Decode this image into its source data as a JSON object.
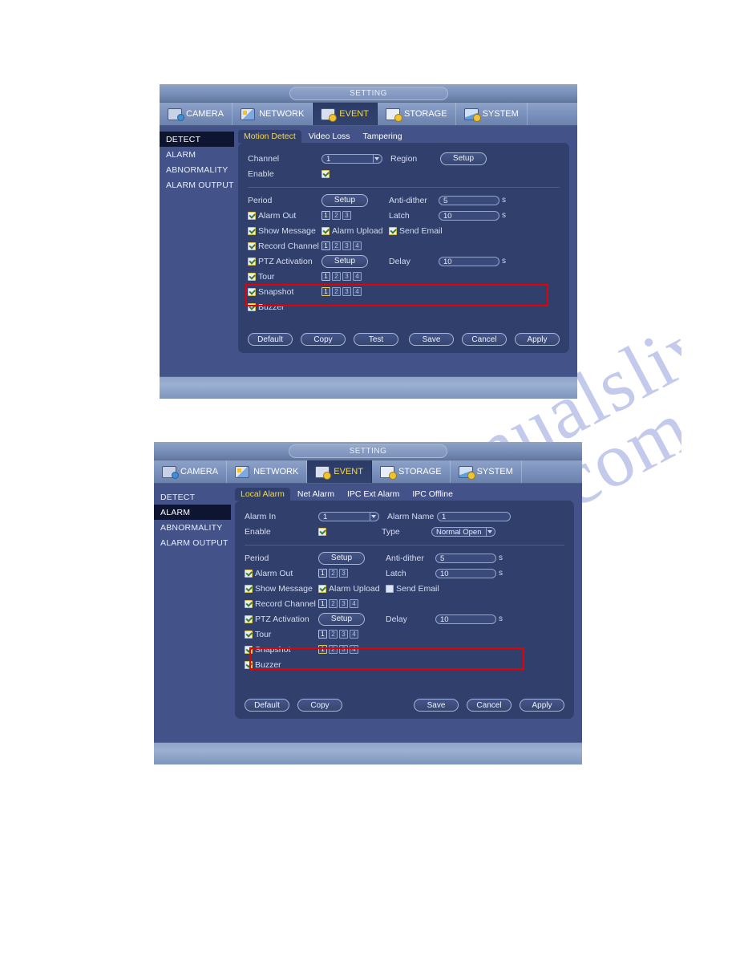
{
  "watermark": {
    "line1": "manualslive.com",
    "line2": "manualslive.com"
  },
  "panels": [
    {
      "title": "SETTING",
      "main_tabs": [
        {
          "label": "CAMERA",
          "icon": "camera-icon",
          "active": false
        },
        {
          "label": "NETWORK",
          "icon": "network-icon",
          "active": false
        },
        {
          "label": "EVENT",
          "icon": "event-icon",
          "active": true
        },
        {
          "label": "STORAGE",
          "icon": "storage-icon",
          "active": false
        },
        {
          "label": "SYSTEM",
          "icon": "system-icon",
          "active": false
        }
      ],
      "sidebar": [
        {
          "label": "DETECT",
          "active": true
        },
        {
          "label": "ALARM",
          "active": false
        },
        {
          "label": "ABNORMALITY",
          "active": false
        },
        {
          "label": "ALARM OUTPUT",
          "active": false
        }
      ],
      "sub_tabs": [
        {
          "label": "Motion Detect",
          "active": true
        },
        {
          "label": "Video Loss",
          "active": false
        },
        {
          "label": "Tampering",
          "active": false
        }
      ],
      "form": {
        "channel_label": "Channel",
        "channel_value": "1",
        "region_label": "Region",
        "region_button": "Setup",
        "enable_label": "Enable",
        "enable_checked": true,
        "period_label": "Period",
        "period_button": "Setup",
        "antidither_label": "Anti-dither",
        "antidither_value": "5",
        "antidither_unit": "s",
        "alarm_out_label": "Alarm Out",
        "alarm_out_checked": true,
        "alarm_out_channels": [
          "1",
          "2",
          "3"
        ],
        "alarm_out_selected": [
          "1"
        ],
        "latch_label": "Latch",
        "latch_value": "10",
        "latch_unit": "s",
        "show_message_label": "Show Message",
        "show_message_checked": true,
        "alarm_upload_label": "Alarm Upload",
        "alarm_upload_checked": true,
        "send_email_label": "Send Email",
        "send_email_checked": true,
        "record_channel_label": "Record Channel",
        "record_channel_checked": true,
        "record_channels": [
          "1",
          "2",
          "3",
          "4"
        ],
        "record_selected": [
          "1"
        ],
        "ptz_label": "PTZ Activation",
        "ptz_checked": true,
        "ptz_button": "Setup",
        "delay_label": "Delay",
        "delay_value": "10",
        "delay_unit": "s",
        "tour_label": "Tour",
        "tour_checked": true,
        "tour_channels": [
          "1",
          "2",
          "3",
          "4"
        ],
        "tour_selected": [
          "1"
        ],
        "snapshot_label": "Snapshot",
        "snapshot_checked": true,
        "snapshot_channels": [
          "1",
          "2",
          "3",
          "4"
        ],
        "snapshot_selected": [
          "1"
        ],
        "buzzer_label": "Buzzer",
        "buzzer_checked": true
      },
      "buttons_left": [
        "Default",
        "Copy",
        "Test"
      ],
      "buttons_right": [
        "Save",
        "Cancel",
        "Apply"
      ]
    },
    {
      "title": "SETTING",
      "main_tabs": [
        {
          "label": "CAMERA",
          "icon": "camera-icon",
          "active": false
        },
        {
          "label": "NETWORK",
          "icon": "network-icon",
          "active": false
        },
        {
          "label": "EVENT",
          "icon": "event-icon",
          "active": true
        },
        {
          "label": "STORAGE",
          "icon": "storage-icon",
          "active": false
        },
        {
          "label": "SYSTEM",
          "icon": "system-icon",
          "active": false
        }
      ],
      "sidebar": [
        {
          "label": "DETECT",
          "active": false
        },
        {
          "label": "ALARM",
          "active": true
        },
        {
          "label": "ABNORMALITY",
          "active": false
        },
        {
          "label": "ALARM OUTPUT",
          "active": false
        }
      ],
      "sub_tabs": [
        {
          "label": "Local Alarm",
          "active": true
        },
        {
          "label": "Net Alarm",
          "active": false
        },
        {
          "label": "IPC Ext Alarm",
          "active": false
        },
        {
          "label": "IPC Offline",
          "active": false
        }
      ],
      "form": {
        "alarm_in_label": "Alarm In",
        "alarm_in_value": "1",
        "alarm_name_label": "Alarm Name",
        "alarm_name_value": "1",
        "enable_label": "Enable",
        "enable_checked": true,
        "type_label": "Type",
        "type_value": "Normal Open",
        "period_label": "Period",
        "period_button": "Setup",
        "antidither_label": "Anti-dither",
        "antidither_value": "5",
        "antidither_unit": "s",
        "alarm_out_label": "Alarm Out",
        "alarm_out_checked": true,
        "alarm_out_channels": [
          "1",
          "2",
          "3"
        ],
        "alarm_out_selected": [
          "1"
        ],
        "latch_label": "Latch",
        "latch_value": "10",
        "latch_unit": "s",
        "show_message_label": "Show Message",
        "show_message_checked": true,
        "alarm_upload_label": "Alarm Upload",
        "alarm_upload_checked": true,
        "send_email_label": "Send Email",
        "send_email_checked": false,
        "record_channel_label": "Record Channel",
        "record_channel_checked": true,
        "record_channels": [
          "1",
          "2",
          "3",
          "4"
        ],
        "record_selected": [
          "1"
        ],
        "ptz_label": "PTZ Activation",
        "ptz_checked": true,
        "ptz_button": "Setup",
        "delay_label": "Delay",
        "delay_value": "10",
        "delay_unit": "s",
        "tour_label": "Tour",
        "tour_checked": true,
        "tour_channels": [
          "1",
          "2",
          "3",
          "4"
        ],
        "tour_selected": [
          "1"
        ],
        "snapshot_label": "Snapshot",
        "snapshot_checked": true,
        "snapshot_channels": [
          "1",
          "2",
          "3",
          "4"
        ],
        "snapshot_selected": [
          "1"
        ],
        "buzzer_label": "Buzzer",
        "buzzer_checked": true
      },
      "buttons_left": [
        "Default",
        "Copy"
      ],
      "buttons_right": [
        "Save",
        "Cancel",
        "Apply"
      ]
    }
  ],
  "colors": {
    "accent_yellow": "#f3d84e",
    "panel_bg": "#313f6d",
    "window_bg": "#43538a",
    "highlight_red": "#e60000"
  }
}
